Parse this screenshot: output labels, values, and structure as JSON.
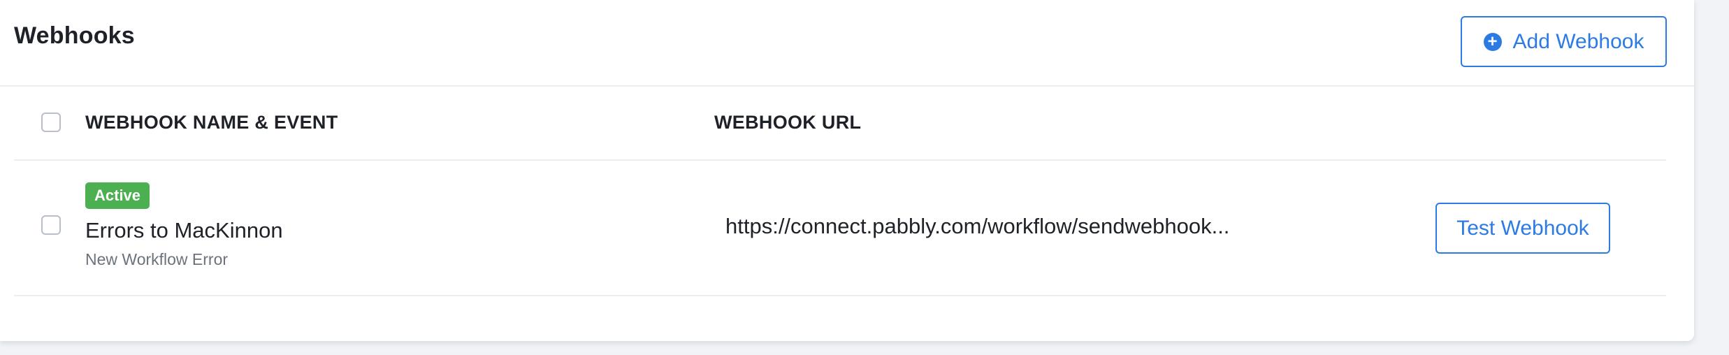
{
  "header": {
    "title": "Webhooks",
    "add_button_label": "Add Webhook",
    "add_button_icon": "plus-circle-icon"
  },
  "table": {
    "columns": [
      "WEBHOOK NAME & EVENT",
      "WEBHOOK URL"
    ],
    "rows": [
      {
        "status": "Active",
        "name": "Errors to MacKinnon",
        "event": "New Workflow Error",
        "url": "https://connect.pabbly.com/workflow/sendwebhook...",
        "action_label": "Test Webhook"
      }
    ]
  },
  "colors": {
    "accent": "#2c7be5",
    "active_badge": "#4caf50",
    "text": "#1f2129",
    "muted_text": "#6c727c",
    "divider": "#e9eef5",
    "page_background": "#f1f3f6"
  }
}
